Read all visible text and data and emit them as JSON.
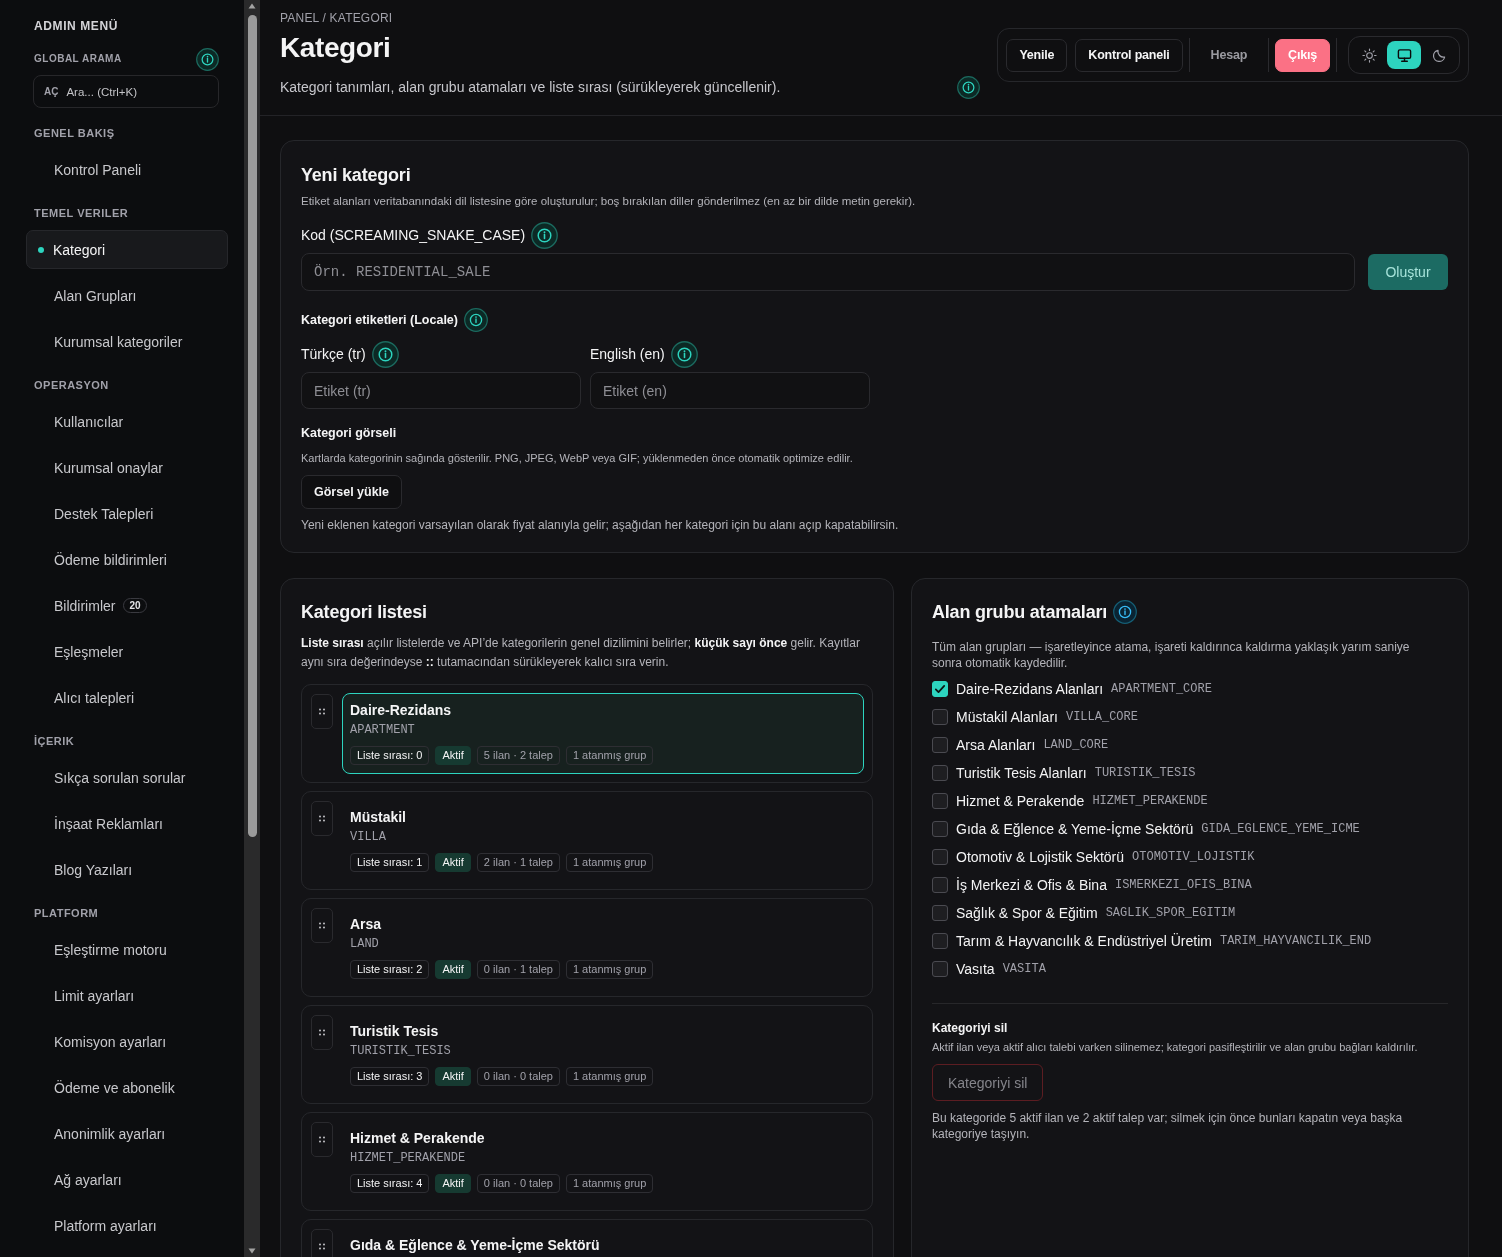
{
  "sidebar": {
    "title": "ADMIN MENÜ",
    "search": {
      "label": "GLOBAL ARAMA",
      "tag": "AÇ",
      "placeholder": "Ara... (Ctrl+K)"
    },
    "sections": [
      {
        "label": "GENEL BAKIŞ",
        "items": [
          {
            "label": "Kontrol Paneli",
            "selected": false
          }
        ]
      },
      {
        "label": "TEMEL VERILER",
        "items": [
          {
            "label": "Kategori",
            "selected": true
          },
          {
            "label": "Alan Grupları",
            "selected": false
          },
          {
            "label": "Kurumsal kategoriler",
            "selected": false
          }
        ]
      },
      {
        "label": "OPERASYON",
        "items": [
          {
            "label": "Kullanıcılar",
            "selected": false
          },
          {
            "label": "Kurumsal onaylar",
            "selected": false
          },
          {
            "label": "Destek Talepleri",
            "selected": false
          },
          {
            "label": "Ödeme bildirimleri",
            "selected": false
          },
          {
            "label": "Bildirimler",
            "badge": "20",
            "selected": false
          },
          {
            "label": "Eşleşmeler",
            "selected": false
          },
          {
            "label": "Alıcı talepleri",
            "selected": false
          }
        ]
      },
      {
        "label": "İÇERIK",
        "items": [
          {
            "label": "Sıkça sorulan sorular",
            "selected": false
          },
          {
            "label": "İnşaat Reklamları",
            "selected": false
          },
          {
            "label": "Blog Yazıları",
            "selected": false
          }
        ]
      },
      {
        "label": "PLATFORM",
        "items": [
          {
            "label": "Eşleştirme motoru",
            "selected": false
          },
          {
            "label": "Limit ayarları",
            "selected": false
          },
          {
            "label": "Komisyon ayarları",
            "selected": false
          },
          {
            "label": "Ödeme ve abonelik",
            "selected": false
          },
          {
            "label": "Anonimlik ayarları",
            "selected": false
          },
          {
            "label": "Ağ ayarları",
            "selected": false
          },
          {
            "label": "Platform ayarları",
            "selected": false
          }
        ]
      }
    ]
  },
  "header": {
    "breadcrumb": "PANEL / KATEGORI",
    "title": "Kategori",
    "subtitle": "Kategori tanımları, alan grubu atamaları ve liste sırası (sürükleyerek güncellenir).",
    "actions": [
      {
        "kind": "outline",
        "label": "Yenile"
      },
      {
        "kind": "outline",
        "label": "Kontrol paneli"
      },
      {
        "kind": "ghost",
        "label": "Hesap"
      },
      {
        "kind": "danger",
        "label": "Çıkış"
      }
    ],
    "theme_options": [
      {
        "kind": "light",
        "selected": false
      },
      {
        "kind": "system",
        "selected": true
      },
      {
        "kind": "dark",
        "selected": false
      }
    ]
  },
  "new_category": {
    "title": "Yeni kategori",
    "description": "Etiket alanları veritabanındaki dil listesine göre oluşturulur; boş bırakılan diller gönderilmez (en az bir dilde metin gerekir).",
    "code_label": "Kod (SCREAMING_SNAKE_CASE)",
    "code_placeholder": "Örn. RESIDENTIAL_SALE",
    "submit": "Oluştur",
    "labels_title": "Kategori etiketleri (Locale)",
    "locales": [
      {
        "label": "Türkçe (tr)",
        "placeholder": "Etiket (tr)"
      },
      {
        "label": "English (en)",
        "placeholder": "Etiket (en)"
      }
    ],
    "image_title": "Kategori görseli",
    "image_description": "Kartlarda kategorinin sağında gösterilir. PNG, JPEG, WebP veya GIF; yüklenmeden önce otomatik optimize edilir.",
    "upload": "Görsel yükle",
    "note": "Yeni eklenen kategori varsayılan olarak fiyat alanıyla gelir; aşağıdan her kategori için bu alanı açıp kapatabilirsin."
  },
  "category_list": {
    "title": "Kategori listesi",
    "description": "**Liste sırası** açılır listelerde ve API’de kategorilerin genel dizilimini belirler; **küçük sayı önce** gelir. Kayıtlar aynı sıra değerindeyse **::** tutamacından sürükleyerek kalıcı sıra verin.",
    "items": [
      {
        "name": "Daire-Rezidans",
        "code": "APARTMENT",
        "order": "Liste sırası: 0",
        "status": "Aktif",
        "active": true,
        "counts": "5 ilan · 2 talep",
        "groups": "1 atanmış grup",
        "selected": true
      },
      {
        "name": "Müstakil",
        "code": "VILLA",
        "order": "Liste sırası: 1",
        "status": "Aktif",
        "active": true,
        "counts": "2 ilan · 1 talep",
        "groups": "1 atanmış grup",
        "selected": false
      },
      {
        "name": "Arsa",
        "code": "LAND",
        "order": "Liste sırası: 2",
        "status": "Aktif",
        "active": true,
        "counts": "0 ilan · 1 talep",
        "groups": "1 atanmış grup",
        "selected": false
      },
      {
        "name": "Turistik Tesis",
        "code": "TURISTIK_TESIS",
        "order": "Liste sırası: 3",
        "status": "Aktif",
        "active": true,
        "counts": "0 ilan · 0 talep",
        "groups": "1 atanmış grup",
        "selected": false
      },
      {
        "name": "Hizmet & Perakende",
        "code": "HIZMET_PERAKENDE",
        "order": "Liste sırası: 4",
        "status": "Aktif",
        "active": true,
        "counts": "0 ilan · 0 talep",
        "groups": "1 atanmış grup",
        "selected": false
      },
      {
        "name": "Gıda & Eğlence & Yeme-İçme Sektörü",
        "selected": false
      }
    ]
  },
  "group_assignments": {
    "title": "Alan grubu atamaları",
    "description": "Tüm alan grupları — işaretleyince atama, işareti kaldırınca kaldırma yaklaşık yarım saniye sonra otomatik kaydedilir.",
    "groups": [
      {
        "name": "Daire-Rezidans Alanları",
        "code": "APARTMENT_CORE",
        "checked": true
      },
      {
        "name": "Müstakil Alanları",
        "code": "VILLA_CORE",
        "checked": false
      },
      {
        "name": "Arsa Alanları",
        "code": "LAND_CORE",
        "checked": false
      },
      {
        "name": "Turistik Tesis Alanları",
        "code": "TURISTIK_TESIS",
        "checked": false
      },
      {
        "name": "Hizmet & Perakende",
        "code": "HIZMET_PERAKENDE",
        "checked": false
      },
      {
        "name": "Gıda & Eğlence & Yeme-İçme Sektörü",
        "code": "GIDA_EGLENCE_YEME_ICME",
        "checked": false
      },
      {
        "name": "Otomotiv & Lojistik Sektörü",
        "code": "OTOMOTIV_LOJISTIK",
        "checked": false
      },
      {
        "name": "İş Merkezi & Ofis & Bina",
        "code": "ISMERKEZI_OFIS_BINA",
        "checked": false
      },
      {
        "name": "Sağlık & Spor & Eğitim",
        "code": "SAGLIK_SPOR_EGITIM",
        "checked": false
      },
      {
        "name": "Tarım & Hayvancılık & Endüstriyel Üretim",
        "code": "TARIM_HAYVANCILIK_END",
        "checked": false
      },
      {
        "name": "Vasıta",
        "code": "VASITA",
        "checked": false
      }
    ],
    "delete": {
      "title": "Kategoriyi sil",
      "description": "Aktif ilan veya aktif alıcı talebi varken silinemez; kategori pasifleştirilir ve alan grubu bağları kaldırılır.",
      "button": "Kategoriyi sil",
      "disabled": true,
      "note": "Bu kategoride 5 aktif ilan ve 2 aktif talep var; silmek için önce bunları kapatın veya başka kategoriye taşıyın."
    }
  }
}
